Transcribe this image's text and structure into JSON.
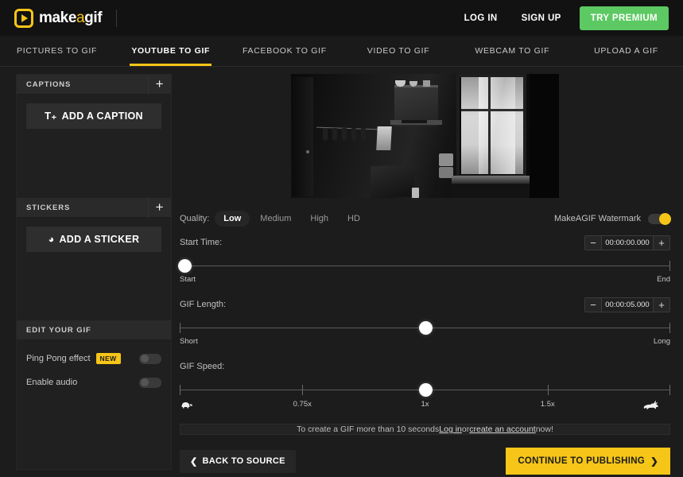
{
  "header": {
    "logo_text_1": "make",
    "logo_text_a": "a",
    "logo_text_2": "gif",
    "login": "LOG IN",
    "signup": "SIGN UP",
    "premium": "TRY PREMIUM",
    "premium_color": "#5cc963"
  },
  "tabs": [
    {
      "label": "PICTURES TO GIF",
      "active": false
    },
    {
      "label": "YOUTUBE TO GIF",
      "active": true
    },
    {
      "label": "FACEBOOK TO GIF",
      "active": false
    },
    {
      "label": "VIDEO TO GIF",
      "active": false
    },
    {
      "label": "WEBCAM TO GIF",
      "active": false
    },
    {
      "label": "UPLOAD A GIF",
      "active": false
    }
  ],
  "sidebar": {
    "captions": {
      "title": "CAPTIONS",
      "add_label": "ADD A CAPTION",
      "plus": "+"
    },
    "stickers": {
      "title": "STICKERS",
      "add_label": "ADD A STICKER",
      "plus": "+"
    },
    "edit": {
      "title": "EDIT YOUR GIF",
      "rows": [
        {
          "label": "Ping Pong effect",
          "badge": "NEW",
          "on": false
        },
        {
          "label": "Enable audio",
          "badge": "",
          "on": false
        }
      ]
    }
  },
  "main": {
    "quality": {
      "label": "Quality:",
      "options": [
        "Low",
        "Medium",
        "High",
        "HD"
      ],
      "selected": "Low"
    },
    "watermark": {
      "label": "MakeAGIF Watermark",
      "on": true,
      "color": "#f5c518"
    },
    "start_time": {
      "label": "Start Time:",
      "value": "00:00:00.000",
      "minus": "−",
      "plus": "+",
      "left_end": "Start",
      "right_end": "End",
      "handle_percent": 1
    },
    "gif_length": {
      "label": "GIF Length:",
      "value": "00:00:05.000",
      "minus": "−",
      "plus": "+",
      "left_end": "Short",
      "right_end": "Long",
      "handle_percent": 50
    },
    "gif_speed": {
      "label": "GIF Speed:",
      "ticks": [
        {
          "label": "",
          "percent": 0
        },
        {
          "label": "0.75x",
          "percent": 25
        },
        {
          "label": "1x",
          "percent": 50
        },
        {
          "label": "1.5x",
          "percent": 75
        },
        {
          "label": "",
          "percent": 100
        }
      ],
      "handle_percent": 50,
      "slow_icon": "turtle-icon",
      "fast_icon": "rabbit-icon"
    },
    "note": {
      "text_before": "To create a GIF more than 10 seconds ",
      "link1": "Log in",
      "text_middle": " or ",
      "link2": "create an account",
      "text_after": " now!"
    },
    "footer": {
      "back": "BACK TO SOURCE",
      "back_chevron": "❮",
      "continue": "CONTINUE TO PUBLISHING",
      "continue_chevron": "❯"
    }
  }
}
